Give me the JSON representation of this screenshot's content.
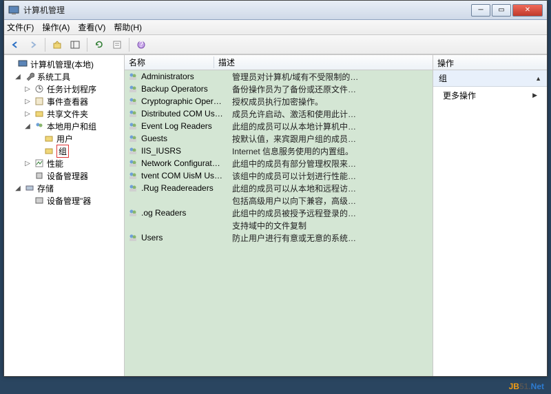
{
  "window": {
    "title": "计算机管理"
  },
  "menu": {
    "file": "文件(F)",
    "action": "操作(A)",
    "view": "查看(V)",
    "help": "帮助(H)"
  },
  "tree": {
    "root": "计算机管理(本地)",
    "sys_tools": "系统工具",
    "task_sched": "任务计划程序",
    "event_viewer": "事件查看器",
    "shared_folders": "共享文件夹",
    "local_users_groups": "本地用户和组",
    "users": "用户",
    "groups": "组",
    "performance": "性能",
    "device_mgr": "设备管理器",
    "storage": "存储",
    "disk_mgmt": "设备管理\"器"
  },
  "list": {
    "headers": {
      "name": "名称",
      "desc": "描述"
    },
    "rows": [
      {
        "name": "Administrators",
        "desc": "管理员对计算机/域有不受限制的…"
      },
      {
        "name": "Backup Operators",
        "desc": "备份操作员为了备份或还原文件…"
      },
      {
        "name": "Cryptographic Oper…",
        "desc": "授权成员执行加密操作。"
      },
      {
        "name": "Distributed COM Us…",
        "desc": "成员允许启动、激活和使用此计…"
      },
      {
        "name": "Event Log Readers",
        "desc": "此组的成员可以从本地计算机中…"
      },
      {
        "name": "Guests",
        "desc": "按默认值，来宾跟用户组的成员…"
      },
      {
        "name": "IIS_IUSRS",
        "desc": "Internet 信息服务使用的内置组。"
      },
      {
        "name": "Network Configurat…",
        "desc": "此组中的成员有部分管理权限来…"
      },
      {
        "name": "tvent COM UisM Us…",
        "desc": "该组中的成员可以计划进行性能…"
      },
      {
        "name": ".Rug Readereaders",
        "desc": "此组的成员可以从本地和远程访…"
      },
      {
        "name": "",
        "desc": "包括高级用户以向下兼容，高级…"
      },
      {
        "name": ".og Readers",
        "desc": "此组中的成员被授予远程登录的…"
      },
      {
        "name": "",
        "desc": "支持域中的文件复制"
      },
      {
        "name": "Users",
        "desc": "防止用户进行有意或无意的系统…"
      }
    ]
  },
  "actions": {
    "header": "操作",
    "group": "组",
    "more": "更多操作"
  },
  "watermark": {
    "jb": "JB",
    "num": "51.",
    "net": "Net"
  }
}
